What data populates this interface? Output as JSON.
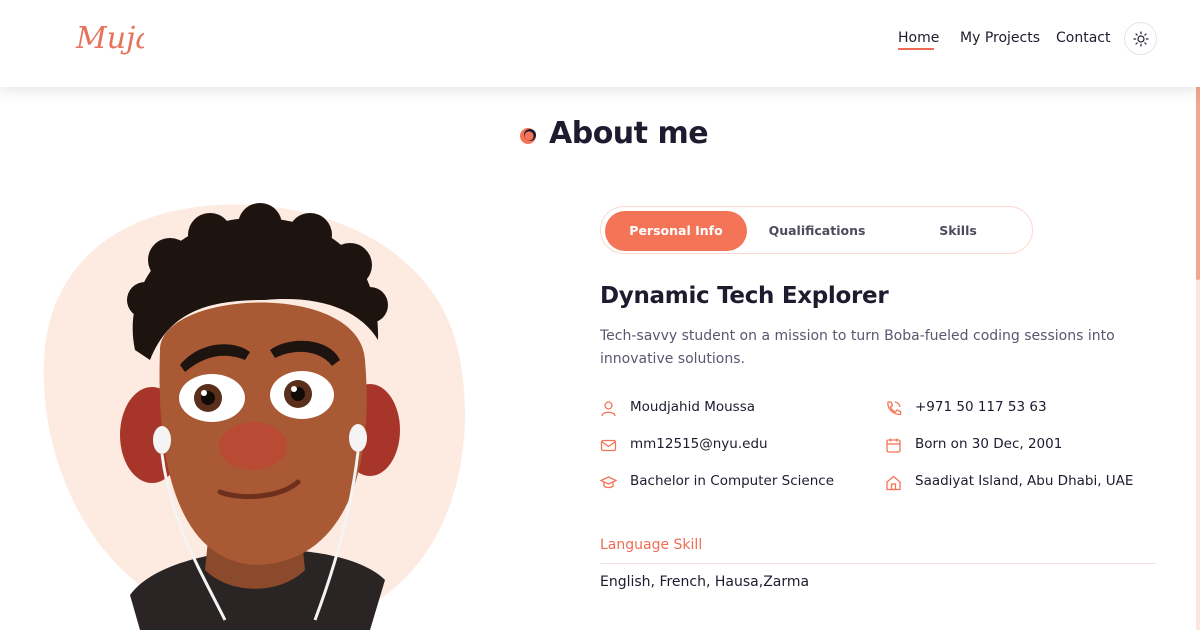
{
  "brand": {
    "logo_text": "Muja"
  },
  "nav": {
    "items": [
      {
        "label": "Home",
        "active": true
      },
      {
        "label": "My Projects",
        "active": false
      },
      {
        "label": "Contact",
        "active": false
      }
    ],
    "theme_icon": "sun-icon"
  },
  "section": {
    "title": "About me",
    "title_icon": "orbit-dot-icon"
  },
  "avatar": {
    "alt": "avatar-illustration"
  },
  "tabs": [
    {
      "label": "Personal Info",
      "active": true
    },
    {
      "label": "Qualifications",
      "active": false
    },
    {
      "label": "Skills",
      "active": false
    }
  ],
  "profile": {
    "heading": "Dynamic Tech Explorer",
    "description": "Tech-savvy student on a mission to turn Boba-fueled coding sessions into innovative solutions.",
    "info": [
      {
        "icon": "user-icon",
        "text": "Moudjahid Moussa"
      },
      {
        "icon": "phone-icon",
        "text": "+971 50 117 53 63"
      },
      {
        "icon": "mail-icon",
        "text": "mm12515@nyu.edu"
      },
      {
        "icon": "calendar-icon",
        "text": "Born on 30 Dec, 2001"
      },
      {
        "icon": "graduation-cap-icon",
        "text": "Bachelor in Computer Science"
      },
      {
        "icon": "home-icon",
        "text": "Saadiyat Island, Abu Dhabi, UAE"
      }
    ],
    "language": {
      "label": "Language Skill",
      "value": "English, French, Hausa,Zarma"
    }
  },
  "colors": {
    "accent": "#f47458",
    "text_dark": "#1e1b2e",
    "text_muted": "#5c5670",
    "blob": "#fdebe1"
  }
}
